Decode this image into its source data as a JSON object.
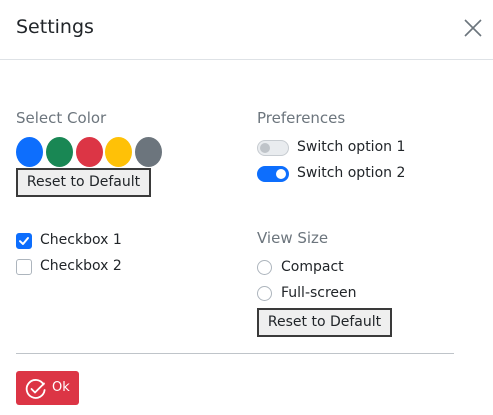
{
  "dialog": {
    "title": "Settings",
    "close_icon": "close-icon"
  },
  "select_color": {
    "title": "Select Color",
    "colors": [
      {
        "name": "blue",
        "hex": "#0d6efd"
      },
      {
        "name": "green",
        "hex": "#198754"
      },
      {
        "name": "red",
        "hex": "#dc3545"
      },
      {
        "name": "yellow",
        "hex": "#ffc107"
      },
      {
        "name": "gray",
        "hex": "#6c757d"
      }
    ],
    "reset_label": "Reset to Default"
  },
  "preferences": {
    "title": "Preferences",
    "switches": [
      {
        "label": "Switch option 1",
        "checked": false
      },
      {
        "label": "Switch option 2",
        "checked": true
      }
    ]
  },
  "checkboxes": [
    {
      "label": "Checkbox 1",
      "checked": true
    },
    {
      "label": "Checkbox 2",
      "checked": false
    }
  ],
  "view_size": {
    "title": "View Size",
    "options": [
      {
        "label": "Compact",
        "selected": false
      },
      {
        "label": "Full-screen",
        "selected": false
      }
    ],
    "reset_label": "Reset to Default"
  },
  "footer": {
    "ok_label": "Ok",
    "ok_icon": "check-circle-icon",
    "ok_color": "#dc3545"
  }
}
